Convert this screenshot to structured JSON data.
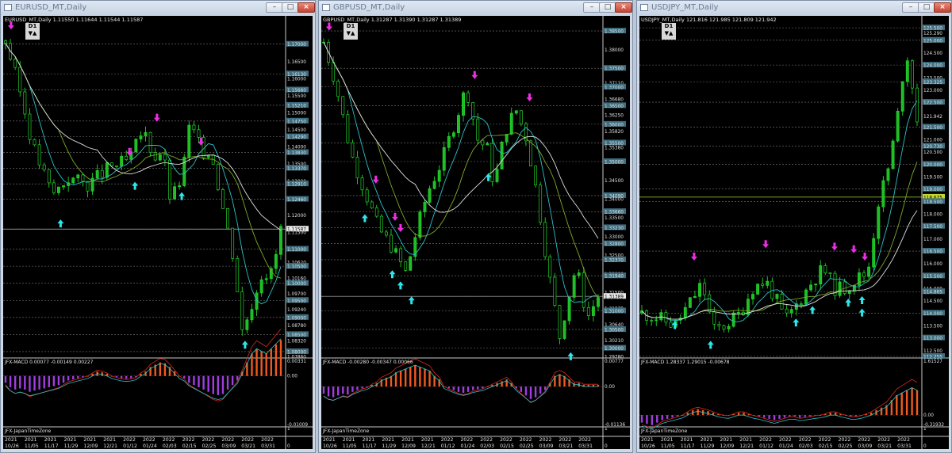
{
  "windows": [
    {
      "id": "eurusd",
      "title": "EURUSD_MT,Daily",
      "symbol_line": "EURUSD_MT,Daily  1.11550 1.11644 1.11544 1.11587",
      "timeframe": "D1",
      "macd_line": "JFX-MACD 0.00077 -0.00149 0.00227",
      "timezone_label": "JFX-JapanTimeZone",
      "price_labels": [
        "1.17000",
        "1.16500",
        "1.16130",
        "1.16000",
        "1.15660",
        "1.15500",
        "1.15210",
        "1.15000",
        "1.14750",
        "1.14500",
        "1.14290",
        "1.14000",
        "1.13830",
        "1.13500",
        "1.13370",
        "1.13000",
        "1.12910",
        "1.12500",
        "1.12460",
        "1.12000",
        "1.11587",
        "1.11500",
        "1.11000",
        "1.10620",
        "1.10500",
        "1.10160",
        "1.10000",
        "1.09700",
        "1.09500",
        "1.09240",
        "1.09000",
        "1.08780",
        "1.08500",
        "1.08320",
        "1.08000",
        "1.07860"
      ],
      "macd_labels": [
        "0.00331",
        "0.00",
        "-0.01009"
      ],
      "zone_labels": [
        "1",
        "0"
      ],
      "date_years": [
        "2021",
        "2021",
        "2021",
        "2021",
        "2021",
        "2021",
        "2022",
        "2022",
        "2022",
        "2022",
        "2022",
        "2022",
        "2022",
        "2022"
      ],
      "date_days": [
        "10/26",
        "11/05",
        "11/17",
        "11/29",
        "12/09",
        "12/21",
        "01/12",
        "01/24",
        "02/03",
        "02/15",
        "02/25",
        "03/09",
        "03/21",
        "03/31"
      ],
      "current_price": "1.11587",
      "price_range": [
        1.0786,
        1.1755
      ],
      "seed": 3,
      "path": [
        [
          0,
          1.171
        ],
        [
          0.05,
          1.157
        ],
        [
          0.1,
          1.14
        ],
        [
          0.17,
          1.126
        ],
        [
          0.23,
          1.131
        ],
        [
          0.3,
          1.129
        ],
        [
          0.38,
          1.134
        ],
        [
          0.45,
          1.136
        ],
        [
          0.5,
          1.145
        ],
        [
          0.54,
          1.137
        ],
        [
          0.57,
          1.139
        ],
        [
          0.6,
          1.124
        ],
        [
          0.64,
          1.131
        ],
        [
          0.67,
          1.147
        ],
        [
          0.71,
          1.139
        ],
        [
          0.75,
          1.138
        ],
        [
          0.79,
          1.122
        ],
        [
          0.83,
          1.107
        ],
        [
          0.86,
          1.086
        ],
        [
          0.89,
          1.093
        ],
        [
          0.93,
          1.103
        ],
        [
          0.97,
          1.103
        ],
        [
          1,
          1.116
        ]
      ],
      "buy_arrows": [
        [
          0.2,
          1.121
        ],
        [
          0.47,
          1.132
        ],
        [
          0.64,
          1.129
        ],
        [
          0.87,
          1.0855
        ]
      ],
      "sell_arrows": [
        [
          0.02,
          1.172
        ],
        [
          0.45,
          1.135
        ],
        [
          0.55,
          1.145
        ],
        [
          0.71,
          1.138
        ]
      ],
      "macd_hist": [
        -0.3,
        -0.5,
        -0.6,
        -0.55,
        -0.6,
        -0.7,
        -0.65,
        -0.6,
        -0.55,
        -0.5,
        -0.45,
        -0.4,
        -0.3,
        -0.2,
        -0.15,
        -0.1,
        -0.05,
        0,
        0.05,
        0.1,
        0.08,
        0.05,
        0,
        -0.05,
        -0.1,
        -0.12,
        -0.1,
        -0.05,
        0.05,
        0.1,
        0.2,
        0.25,
        0.3,
        0.28,
        0.2,
        0.1,
        0,
        -0.1,
        -0.3,
        -0.4,
        -0.5,
        -0.6,
        -0.7,
        -0.8,
        -0.85,
        -0.8,
        -0.6,
        -0.4,
        -0.2,
        0.1,
        0.3,
        0.5,
        0.6,
        0.55,
        0.5,
        0.6,
        0.7,
        0.8
      ]
    },
    {
      "id": "gbpusd",
      "title": "GBPUSD_MT,Daily",
      "symbol_line": "GBPUSD_MT,Daily  1.31287 1.31390 1.31287 1.31389",
      "timeframe": "D1",
      "macd_line": "JFX-MACD -0.00280 -0.00347 0.00066",
      "timezone_label": "JFX-JapanTimeZone",
      "price_labels": [
        "1.38500",
        "1.38000",
        "1.37500",
        "1.37110",
        "1.37000",
        "1.36680",
        "1.36500",
        "1.36250",
        "1.36000",
        "1.35820",
        "1.35500",
        "1.35380",
        "1.35000",
        "1.34500",
        "1.34090",
        "1.34000",
        "1.33660",
        "1.33500",
        "1.33230",
        "1.33000",
        "1.32800",
        "1.32500",
        "1.32370",
        "1.32000",
        "1.31940",
        "1.31500",
        "1.31389",
        "1.31070",
        "1.31000",
        "1.30640",
        "1.30500",
        "1.30210",
        "1.30000",
        "1.29780"
      ],
      "macd_labels": [
        "0.00777",
        "0.00",
        "-0.01136"
      ],
      "zone_labels": [
        "1",
        "0"
      ],
      "date_years": [
        "2021",
        "2021",
        "2021",
        "2021",
        "2021",
        "2021",
        "2022",
        "2022",
        "2022",
        "2022",
        "2022",
        "2022",
        "2022",
        "2022"
      ],
      "date_days": [
        "10/26",
        "11/05",
        "11/17",
        "11/29",
        "12/09",
        "12/21",
        "01/12",
        "01/24",
        "02/03",
        "02/15",
        "02/25",
        "03/09",
        "03/21",
        "03/31"
      ],
      "current_price": "1.31389",
      "price_range": [
        1.2978,
        1.3865
      ],
      "seed": 7,
      "path": [
        [
          0,
          1.382
        ],
        [
          0.04,
          1.372
        ],
        [
          0.1,
          1.352
        ],
        [
          0.15,
          1.342
        ],
        [
          0.2,
          1.332
        ],
        [
          0.25,
          1.327
        ],
        [
          0.3,
          1.32
        ],
        [
          0.34,
          1.332
        ],
        [
          0.38,
          1.342
        ],
        [
          0.43,
          1.35
        ],
        [
          0.48,
          1.361
        ],
        [
          0.52,
          1.37
        ],
        [
          0.56,
          1.356
        ],
        [
          0.6,
          1.353
        ],
        [
          0.62,
          1.343
        ],
        [
          0.66,
          1.358
        ],
        [
          0.7,
          1.364
        ],
        [
          0.74,
          1.356
        ],
        [
          0.78,
          1.34
        ],
        [
          0.82,
          1.32
        ],
        [
          0.86,
          1.303
        ],
        [
          0.88,
          1.31
        ],
        [
          0.92,
          1.322
        ],
        [
          0.96,
          1.308
        ],
        [
          1,
          1.3139
        ]
      ],
      "buy_arrows": [
        [
          0.15,
          1.338
        ],
        [
          0.25,
          1.323
        ],
        [
          0.28,
          1.32
        ],
        [
          0.32,
          1.316
        ],
        [
          0.6,
          1.349
        ],
        [
          0.9,
          1.301
        ]
      ],
      "sell_arrows": [
        [
          0.02,
          1.383
        ],
        [
          0.19,
          1.342
        ],
        [
          0.26,
          1.332
        ],
        [
          0.28,
          1.329
        ],
        [
          0.55,
          1.37
        ],
        [
          0.75,
          1.364
        ]
      ],
      "macd_hist": [
        -0.4,
        -0.55,
        -0.6,
        -0.5,
        -0.4,
        -0.45,
        -0.3,
        -0.2,
        -0.1,
        -0.05,
        0.05,
        0.1,
        0.2,
        0.25,
        0.3,
        0.4,
        0.45,
        0.5,
        0.55,
        0.6,
        0.55,
        0.5,
        0.45,
        0.3,
        0.2,
        0,
        -0.1,
        -0.2,
        -0.3,
        -0.35,
        -0.3,
        -0.2,
        -0.15,
        -0.1,
        0,
        0.05,
        0.1,
        0.15,
        0.2,
        0.1,
        -0.1,
        -0.3,
        -0.5,
        -0.7,
        -0.6,
        -0.4,
        -0.2,
        0.1,
        0.3,
        0.35,
        0.3,
        0.2,
        0.1,
        0.1,
        0.05,
        0.05,
        0.05,
        0.05
      ]
    },
    {
      "id": "usdjpy",
      "title": "USDJPY_MT,Daily",
      "symbol_line": "USDJPY_MT,Daily  121.816 121.985 121.809 121.942",
      "timeframe": "D1",
      "macd_line": "JFX-MACD 1.28337 1.29015 -0.00678",
      "timezone_label": "JFX-JapanTimeZone",
      "price_labels": [
        "125.500",
        "125.290",
        "125.000",
        "124.500",
        "124.000",
        "123.500",
        "123.325",
        "123.000",
        "122.500",
        "121.942",
        "121.500",
        "121.000",
        "120.730",
        "120.500",
        "120.000",
        "119.500",
        "119.000",
        "118.675",
        "118.500",
        "118.000",
        "117.500",
        "117.000",
        "116.500",
        "116.000",
        "115.500",
        "115.000",
        "114.865",
        "114.500",
        "114.000",
        "113.500",
        "113.000",
        "112.500",
        "112.255"
      ],
      "macd_labels": [
        "1.61527",
        "0.00",
        "-0.31932"
      ],
      "zone_labels": [
        "1",
        "0"
      ],
      "date_years": [
        "2021",
        "2021",
        "2021",
        "2021",
        "2021",
        "2021",
        "2022",
        "2022",
        "2022",
        "2022",
        "2022",
        "2022",
        "2022",
        "2022"
      ],
      "date_days": [
        "10/26",
        "11/05",
        "11/17",
        "11/29",
        "12/09",
        "12/21",
        "01/12",
        "01/24",
        "02/03",
        "02/15",
        "02/25",
        "03/09",
        "03/21",
        "03/31"
      ],
      "current_price": "118.675",
      "price_range": [
        112.255,
        125.6
      ],
      "seed": 11,
      "path": [
        [
          0,
          114.0
        ],
        [
          0.06,
          113.8
        ],
        [
          0.12,
          113.5
        ],
        [
          0.18,
          114.5
        ],
        [
          0.22,
          115.2
        ],
        [
          0.26,
          113.3
        ],
        [
          0.3,
          113.5
        ],
        [
          0.36,
          114.0
        ],
        [
          0.4,
          115.0
        ],
        [
          0.45,
          115.3
        ],
        [
          0.49,
          114.5
        ],
        [
          0.52,
          113.7
        ],
        [
          0.56,
          114.3
        ],
        [
          0.62,
          115.3
        ],
        [
          0.66,
          115.8
        ],
        [
          0.7,
          115.0
        ],
        [
          0.74,
          115.0
        ],
        [
          0.78,
          115.4
        ],
        [
          0.82,
          115.6
        ],
        [
          0.86,
          118.5
        ],
        [
          0.9,
          120.0
        ],
        [
          0.93,
          122.0
        ],
        [
          0.96,
          124.7
        ],
        [
          0.98,
          123.3
        ],
        [
          1,
          121.9
        ]
      ],
      "buy_arrows": [
        [
          0.12,
          114.0
        ],
        [
          0.25,
          113.2
        ],
        [
          0.56,
          114.1
        ],
        [
          0.62,
          114.6
        ],
        [
          0.75,
          114.9
        ],
        [
          0.8,
          114.5
        ],
        [
          0.8,
          115.0
        ]
      ],
      "sell_arrows": [
        [
          0.19,
          115.8
        ],
        [
          0.45,
          116.3
        ],
        [
          0.7,
          116.2
        ],
        [
          0.77,
          116.1
        ],
        [
          0.81,
          115.8
        ]
      ],
      "macd_hist": [
        -0.3,
        -0.35,
        -0.4,
        -0.3,
        -0.2,
        -0.15,
        -0.1,
        -0.05,
        0,
        0.05,
        0.1,
        0.12,
        0.1,
        0.08,
        0.05,
        0.02,
        0,
        -0.02,
        0.02,
        0.05,
        0.05,
        0.02,
        -0.02,
        -0.05,
        -0.1,
        -0.15,
        -0.2,
        -0.15,
        -0.1,
        -0.05,
        -0.05,
        -0.1,
        -0.08,
        -0.05,
        -0.02,
        0,
        0.02,
        0.05,
        0.05,
        0.02,
        0,
        -0.05,
        -0.05,
        -0.02,
        0.02,
        0.05,
        0.1,
        0.15,
        0.2,
        0.3,
        0.4,
        0.45,
        0.5,
        0.55,
        0.5
      ]
    }
  ]
}
